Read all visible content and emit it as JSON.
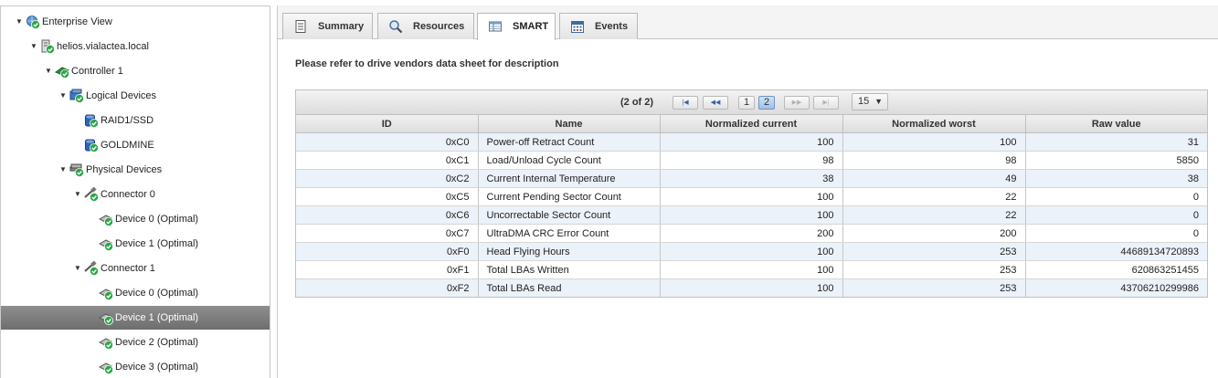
{
  "tree": [
    {
      "label": "Enterprise View",
      "level": 0,
      "expanded": true,
      "icon": "globe-check-icon"
    },
    {
      "label": "helios.vialactea.local",
      "level": 1,
      "expanded": true,
      "icon": "server-check-icon"
    },
    {
      "label": "Controller 1",
      "level": 2,
      "expanded": true,
      "icon": "controller-check-icon"
    },
    {
      "label": "Logical Devices",
      "level": 3,
      "expanded": true,
      "icon": "logical-devices-check-icon"
    },
    {
      "label": "RAID1/SSD",
      "level": 4,
      "expanded": null,
      "icon": "disk-check-icon"
    },
    {
      "label": "GOLDMINE",
      "level": 4,
      "expanded": null,
      "icon": "disk-check-icon"
    },
    {
      "label": "Physical Devices",
      "level": 3,
      "expanded": true,
      "icon": "physical-devices-check-icon"
    },
    {
      "label": "Connector 0",
      "level": 4,
      "expanded": true,
      "icon": "connector-check-icon"
    },
    {
      "label": "Device 0 (Optimal)",
      "level": 5,
      "expanded": null,
      "icon": "drive-check-icon"
    },
    {
      "label": "Device 1 (Optimal)",
      "level": 5,
      "expanded": null,
      "icon": "drive-check-icon"
    },
    {
      "label": "Connector 1",
      "level": 4,
      "expanded": true,
      "icon": "connector-check-icon"
    },
    {
      "label": "Device 0 (Optimal)",
      "level": 5,
      "expanded": null,
      "icon": "drive-check-icon"
    },
    {
      "label": "Device 1 (Optimal)",
      "level": 5,
      "expanded": null,
      "icon": "drive-check-icon",
      "selected": true
    },
    {
      "label": "Device 2 (Optimal)",
      "level": 5,
      "expanded": null,
      "icon": "drive-check-icon"
    },
    {
      "label": "Device 3 (Optimal)",
      "level": 5,
      "expanded": null,
      "icon": "drive-check-icon"
    }
  ],
  "tabs": [
    {
      "label": "Summary",
      "icon": "document-icon",
      "active": false
    },
    {
      "label": "Resources",
      "icon": "magnifier-icon",
      "active": false
    },
    {
      "label": "SMART",
      "icon": "table-icon",
      "active": true
    },
    {
      "label": "Events",
      "icon": "calendar-icon",
      "active": false
    }
  ],
  "note": "Please refer to drive vendors data sheet for description",
  "pager": {
    "info": "(2 of 2)",
    "pages": [
      "1",
      "2"
    ],
    "current_page": "2",
    "page_size": "15",
    "page_size_caret": "▼",
    "first": "|◀",
    "prev": "◀◀",
    "next": "▶▶",
    "last": "▶|"
  },
  "columns": [
    "ID",
    "Name",
    "Normalized current",
    "Normalized worst",
    "Raw value"
  ],
  "rows": [
    [
      "0xC0",
      "Power-off Retract Count",
      "100",
      "100",
      "31"
    ],
    [
      "0xC1",
      "Load/Unload Cycle Count",
      "98",
      "98",
      "5850"
    ],
    [
      "0xC2",
      "Current Internal Temperature",
      "38",
      "49",
      "38"
    ],
    [
      "0xC5",
      "Current Pending Sector Count",
      "100",
      "22",
      "0"
    ],
    [
      "0xC6",
      "Uncorrectable Sector Count",
      "100",
      "22",
      "0"
    ],
    [
      "0xC7",
      "UltraDMA CRC Error Count",
      "200",
      "200",
      "0"
    ],
    [
      "0xF0",
      "Head Flying Hours",
      "100",
      "253",
      "44689134720893"
    ],
    [
      "0xF1",
      "Total LBAs Written",
      "100",
      "253",
      "620863251455"
    ],
    [
      "0xF2",
      "Total LBAs Read",
      "100",
      "253",
      "43706210299986"
    ]
  ],
  "colors": {
    "accent": "#3a64a8",
    "status_ok": "#2aa845",
    "selected_row": "#7e7e7e",
    "alt_row": "#ecf2f9"
  }
}
